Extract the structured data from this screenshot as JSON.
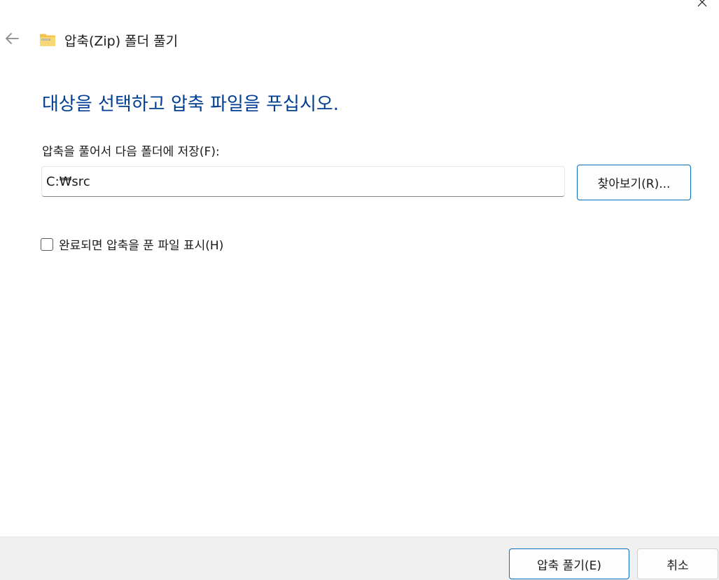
{
  "window": {
    "title": "압축(Zip) 폴더 풀기",
    "close_icon": "close-icon",
    "back_icon": "arrow-left-icon",
    "title_icon": "zip-folder-icon"
  },
  "main": {
    "instruction": "대상을 선택하고 압축 파일을 푸십시오.",
    "destination_label": "압축을 풀어서 다음 폴더에 저장(F):",
    "destination_value": "C:₩src",
    "browse_label": "찾아보기(R)...",
    "show_files_checked": false,
    "show_files_label": "완료되면 압축을 푼 파일 표시(H)"
  },
  "footer": {
    "extract_label": "압축 풀기(E)",
    "cancel_label": "취소"
  },
  "colors": {
    "instruction_text": "#003e92",
    "accent_border": "#0f6cbd",
    "footer_bg": "#f0f0f0"
  }
}
